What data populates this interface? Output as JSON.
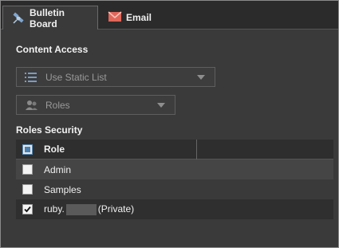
{
  "tabs": [
    {
      "label": "Bulletin Board",
      "icon": "satellite-icon",
      "active": true
    },
    {
      "label": "Email",
      "icon": "envelope-icon",
      "active": false
    }
  ],
  "content_access": {
    "label": "Content Access",
    "source_select": {
      "value": "Use Static List",
      "icon": "list-icon"
    },
    "type_select": {
      "value": "Roles",
      "icon": "users-icon"
    }
  },
  "roles_security": {
    "label": "Roles Security",
    "column_header": "Role",
    "rows": [
      {
        "role": "Admin",
        "checked": false
      },
      {
        "role": "Samples",
        "checked": false
      },
      {
        "role_prefix": "ruby.",
        "role_suffix": "(Private)",
        "checked": true
      }
    ]
  },
  "colors": {
    "background": "#3a3a3a",
    "accent": "#4a7fb0",
    "email_icon": "#e0665a"
  }
}
